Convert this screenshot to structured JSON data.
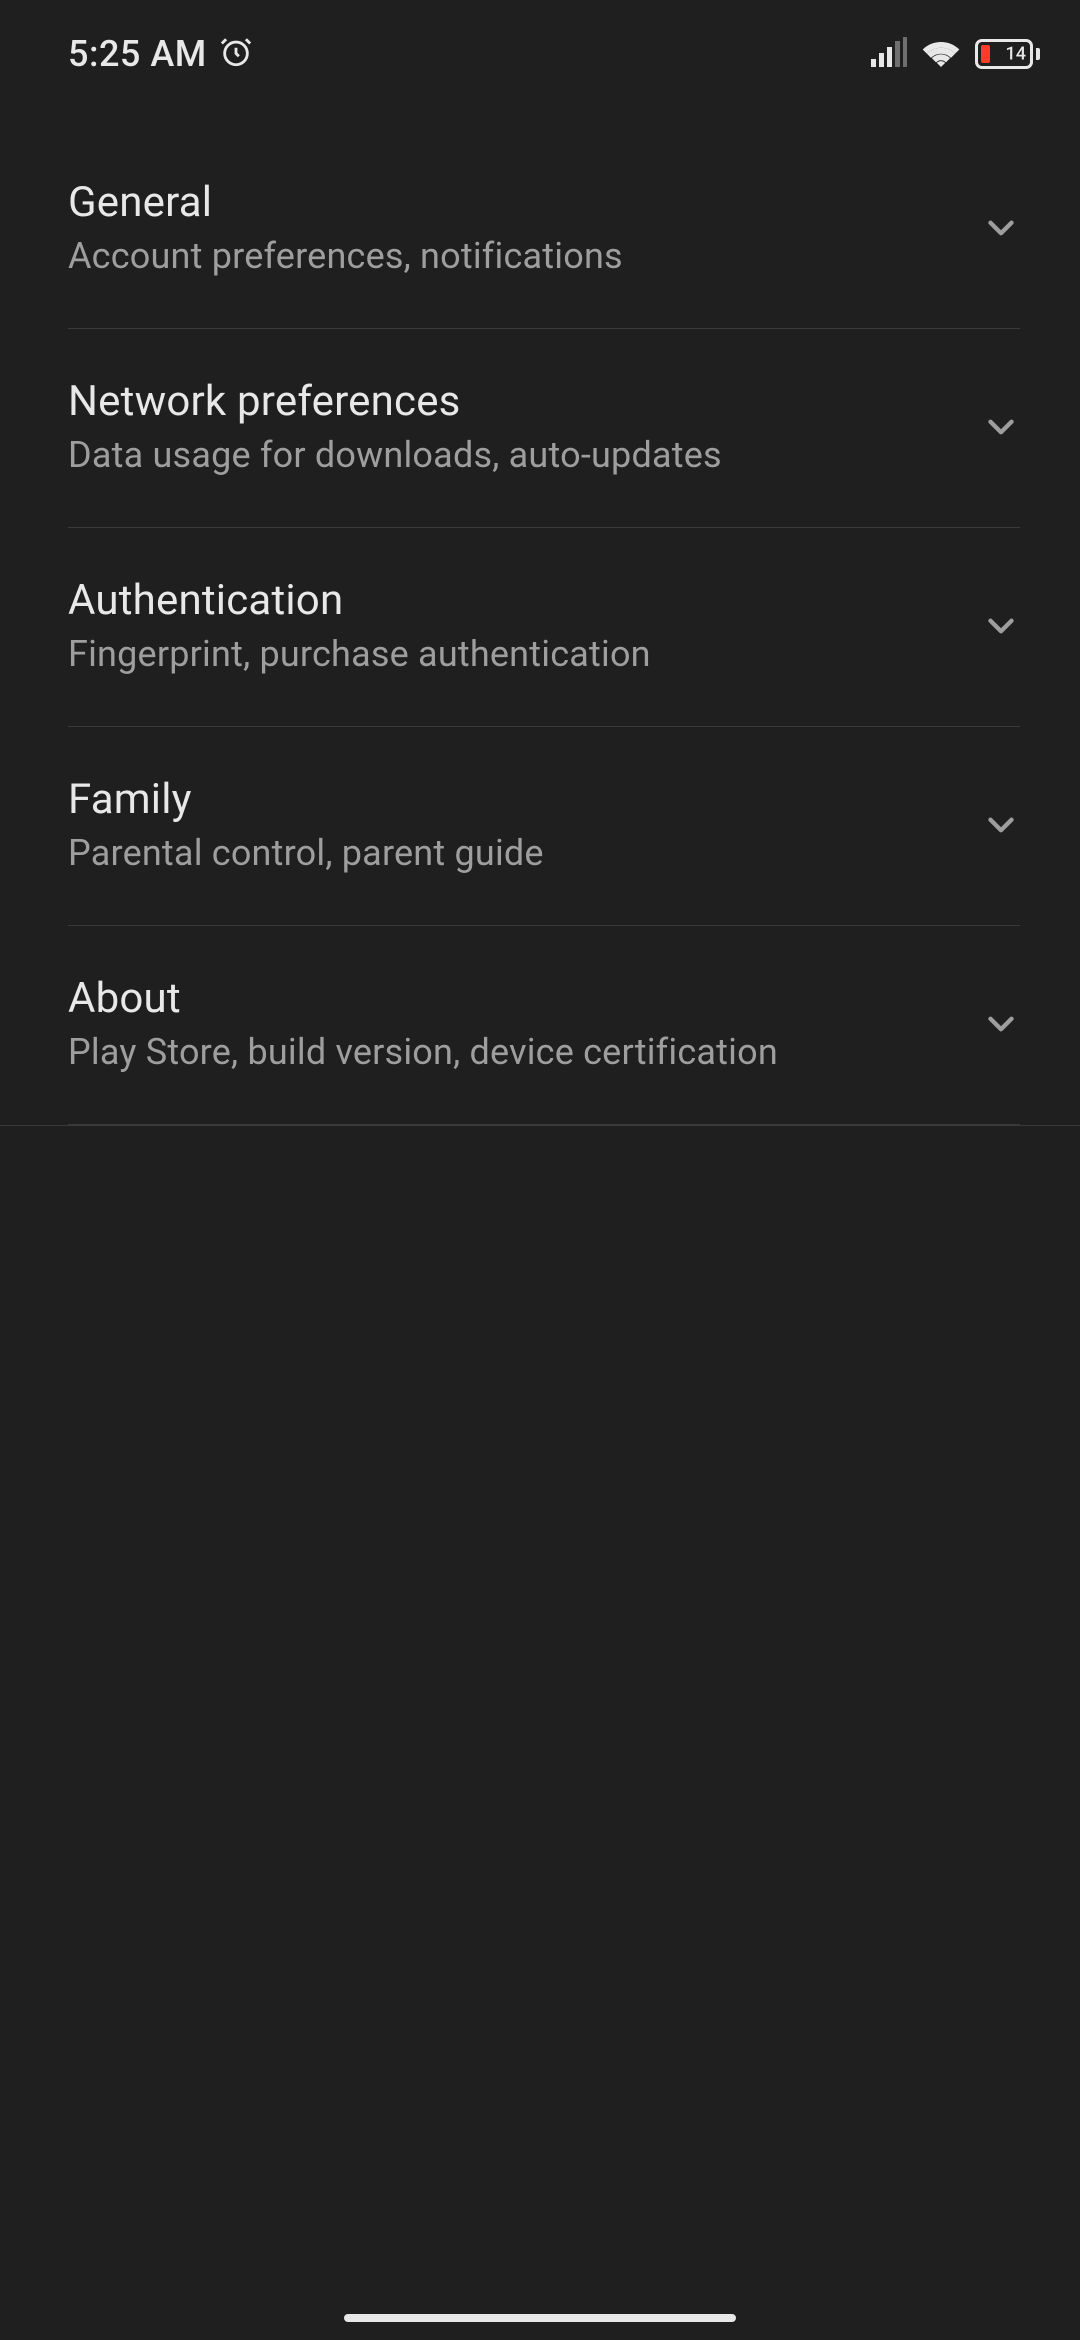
{
  "statusBar": {
    "time": "5:25 AM",
    "batteryLevel": "14"
  },
  "settings": [
    {
      "id": "general",
      "title": "General",
      "subtitle": "Account preferences, notifications"
    },
    {
      "id": "network",
      "title": "Network preferences",
      "subtitle": "Data usage for downloads, auto-updates"
    },
    {
      "id": "authentication",
      "title": "Authentication",
      "subtitle": "Fingerprint, purchase authentication"
    },
    {
      "id": "family",
      "title": "Family",
      "subtitle": "Parental control, parent guide"
    },
    {
      "id": "about",
      "title": "About",
      "subtitle": "Play Store, build version, device certification"
    }
  ]
}
